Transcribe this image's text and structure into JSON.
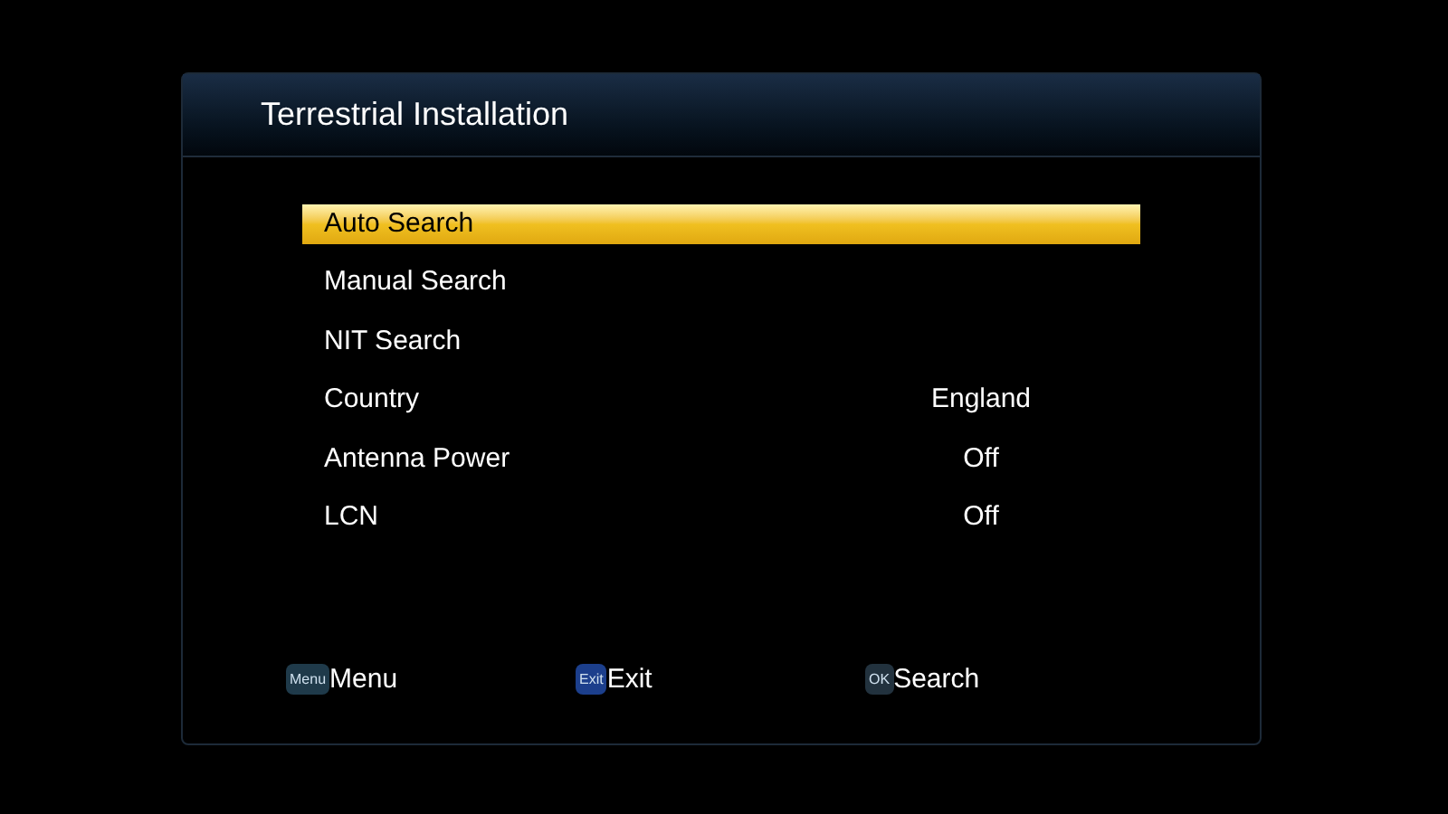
{
  "window": {
    "title": "Terrestrial Installation"
  },
  "menu": [
    {
      "label": "Auto Search",
      "selected": true
    },
    {
      "label": "Manual Search",
      "selected": false
    },
    {
      "label": "NIT Search",
      "selected": false
    },
    {
      "label": "Country",
      "value": "England",
      "selected": false
    },
    {
      "label": "Antenna Power",
      "value": "Off",
      "selected": false
    },
    {
      "label": "LCN",
      "value": "Off",
      "selected": false
    }
  ],
  "hints": [
    {
      "key": "Menu",
      "label": "Menu",
      "color": "#1f3a4a"
    },
    {
      "key": "Exit",
      "label": "Exit",
      "color": "#1c3f8c"
    },
    {
      "key": "OK",
      "label": "Search",
      "color": "#22323e"
    }
  ]
}
